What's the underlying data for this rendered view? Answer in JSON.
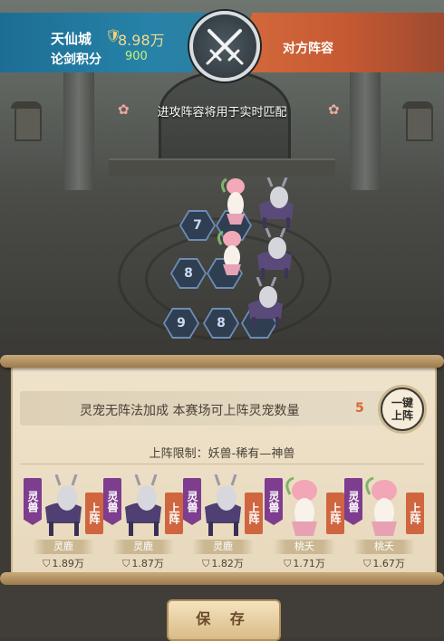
{
  "player": {
    "name": "天仙城",
    "power": "8.98万",
    "score_label": "论剑积分",
    "score": "900"
  },
  "opponent": {
    "label": "对方阵容"
  },
  "notice": "进攻阵容将用于实时匹配",
  "grid": {
    "cells": [
      "7",
      "8",
      "9",
      "8"
    ]
  },
  "panel": {
    "info_text": "灵宠无阵法加成  本赛场可上阵灵宠数量",
    "info_count": "5",
    "auto_deploy": [
      "一键",
      "上阵"
    ],
    "limit_text": "上阵限制：妖兽-稀有—神兽"
  },
  "pets": [
    {
      "type": "灵兽",
      "deploy": "上阵",
      "name": "灵鹿",
      "power": "1.89万",
      "kind": "deer"
    },
    {
      "type": "灵兽",
      "deploy": "上阵",
      "name": "灵鹿",
      "power": "1.87万",
      "kind": "deer"
    },
    {
      "type": "灵兽",
      "deploy": "上阵",
      "name": "灵鹿",
      "power": "1.82万",
      "kind": "deer"
    },
    {
      "type": "灵兽",
      "deploy": "上阵",
      "name": "桃夭",
      "power": "1.71万",
      "kind": "peach"
    },
    {
      "type": "灵兽",
      "deploy": "上阵",
      "name": "桃夭",
      "power": "1.67万",
      "kind": "peach"
    }
  ],
  "save_label": "保 存",
  "colors": {
    "player_banner": "#2682a8",
    "enemy_banner": "#c75a32",
    "pet_type_tag": "#7e3d8e",
    "deploy_tag": "#d06640",
    "count_accent": "#d5673a"
  }
}
